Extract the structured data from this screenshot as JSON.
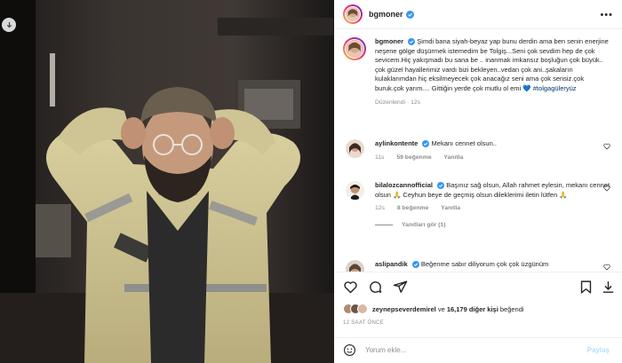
{
  "post": {
    "username": "bgmoner",
    "more_label": "•••",
    "download_icon": "download-icon"
  },
  "caption": {
    "username": "bgmoner",
    "text": "Şimdi bana siyah-beyaz yap bunu derdin ama ben senin enerjine neşene gölge düşürmek istemedim be Tolgiş...Seni çok sevdim hep de çok sevicem.Hiç yakışmadı bu sana be .. inanmak imkansız boşluğun çok büyük.. çok güzel hayallerimiz vardı bizi bekleyen..vedan çok ani..şakaların kulaklarımdan hiç eksilmeyecek çok anacağız seni ama çok sensiz.çok buruk.çok yarım.... Gittiğin yerde çok mutlu ol emi",
    "heart": "💙",
    "hashtag": "#tolgagüleryüz",
    "edited": "Düzenlendi",
    "time": "12s"
  },
  "comments": [
    {
      "username": "aylinkontente",
      "text": "Mekanı cennet olsun..",
      "time": "11s",
      "likes": "59 beğenme",
      "reply": "Yanıtla"
    },
    {
      "username": "bilalozcannofficial",
      "text": "Başınız sağ olsun, Allah rahmet eylesin, mekanı cennet olsun 🙏 Ceyhun beye de geçmiş olsun dileklerimi iletin lütfen 🙏",
      "time": "12s",
      "likes": "8 beğenme",
      "reply": "Yanıtla",
      "view_replies": "Yanıtları gör (1)"
    },
    {
      "username": "aslipandik",
      "text": "Beğenme sabır diliyorum çok çok üzgünüm"
    }
  ],
  "actions": {
    "like_icon": "heart-icon",
    "comment_icon": "comment-icon",
    "share_icon": "share-icon",
    "save_icon": "bookmark-icon",
    "download_icon": "download-icon"
  },
  "likes": {
    "user": "zeynepseverdemirel",
    "connector": "ve",
    "others": "16,179 diğer kişi",
    "suffix": "beğendi"
  },
  "timeago": "12 SAAT ÖNCE",
  "add_comment": {
    "placeholder": "Yorum ekle...",
    "post_label": "Paylaş",
    "emoji_icon": "emoji-icon"
  },
  "colors": {
    "verified": "#3897f0",
    "link": "#00376b",
    "muted": "#8e8e8e",
    "post_disabled": "#b2dffc"
  }
}
